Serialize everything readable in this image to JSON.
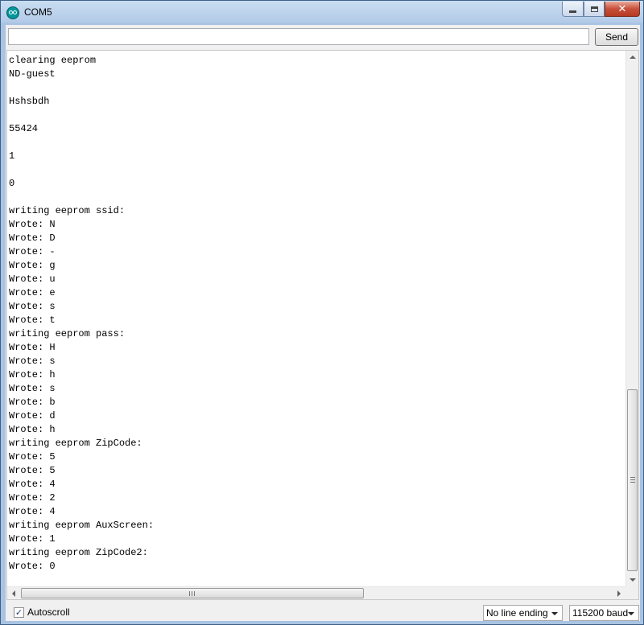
{
  "window": {
    "title": "COM5",
    "controls": {
      "minimize_icon": "minimize-icon",
      "maximize_icon": "maximize-icon",
      "close_icon": "close-icon",
      "close_glyph": "✕"
    }
  },
  "send_bar": {
    "input_value": "",
    "send_label": "Send"
  },
  "output": {
    "lines": [
      "clearing eeprom",
      "ND-guest",
      "",
      "Hshsbdh",
      "",
      "55424",
      "",
      "1",
      "",
      "0",
      "",
      "writing eeprom ssid:",
      "Wrote: N",
      "Wrote: D",
      "Wrote: -",
      "Wrote: g",
      "Wrote: u",
      "Wrote: e",
      "Wrote: s",
      "Wrote: t",
      "writing eeprom pass:",
      "Wrote: H",
      "Wrote: s",
      "Wrote: h",
      "Wrote: s",
      "Wrote: b",
      "Wrote: d",
      "Wrote: h",
      "writing eeprom ZipCode:",
      "Wrote: 5",
      "Wrote: 5",
      "Wrote: 4",
      "Wrote: 2",
      "Wrote: 4",
      "writing eeprom AuxScreen:",
      "Wrote: 1",
      "writing eeprom ZipCode2:",
      "Wrote: 0"
    ]
  },
  "bottom_bar": {
    "autoscroll_label": "Autoscroll",
    "autoscroll_checked": true,
    "line_ending": "No line ending",
    "baud_rate": "115200 baud"
  },
  "colors": {
    "title_bar": "#b3cbe8",
    "close_button": "#c7503a",
    "app_icon": "#00979c"
  }
}
